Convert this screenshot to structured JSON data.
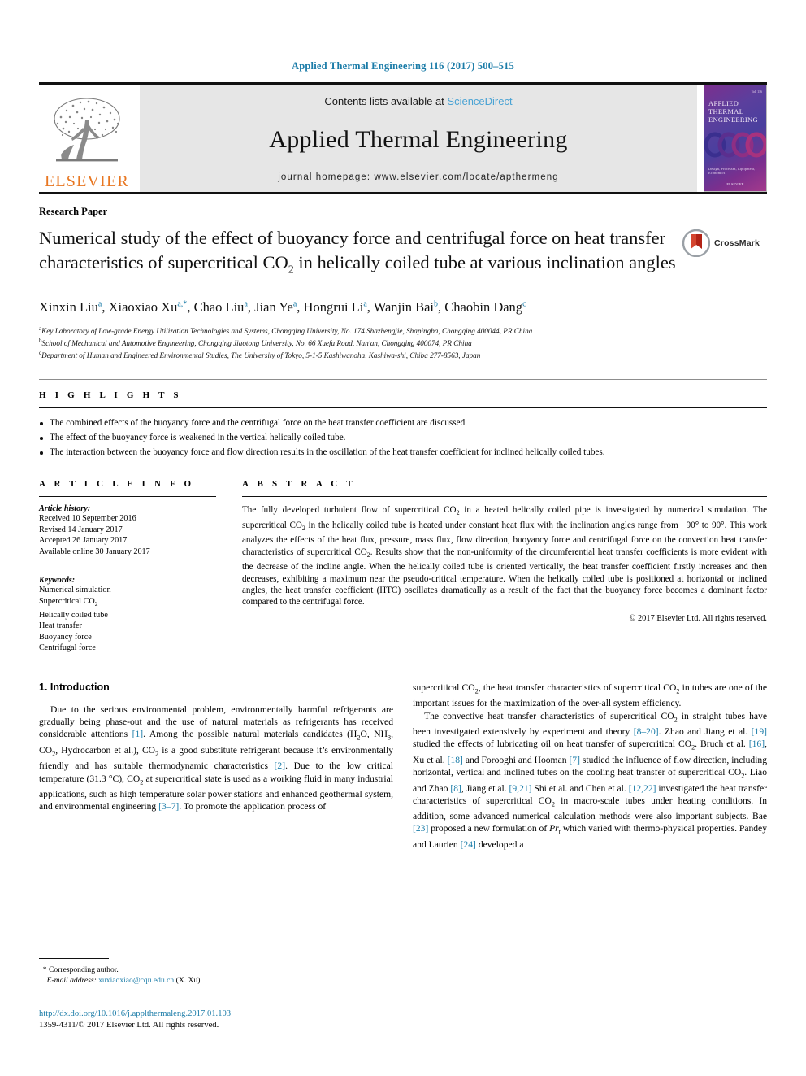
{
  "journal_ref": "Applied Thermal Engineering 116 (2017) 500–515",
  "masthead": {
    "publisher": "ELSEVIER",
    "contents_prefix": "Contents lists available at ",
    "sciencedirect": "ScienceDirect",
    "journal_title": "Applied Thermal Engineering",
    "homepage": "journal homepage: www.elsevier.com/locate/apthermeng",
    "cover": {
      "line1": "APPLIED",
      "line2": "THERMAL",
      "line3": "ENGINEERING",
      "bottom": "Design, Processes, Equipment, Economics",
      "publisher": "ELSEVIER",
      "issue": "Vol. 116"
    }
  },
  "article": {
    "doctype": "Research Paper",
    "title_part1": "Numerical study of the effect of buoyancy force and centrifugal force on heat transfer characteristics of supercritical CO",
    "title_sub": "2",
    "title_part2": " in helically coiled tube at various inclination angles",
    "crossmark_label": "CrossMark",
    "authors": [
      {
        "name": "Xinxin Liu",
        "sup": "a",
        "sep": ", "
      },
      {
        "name": "Xiaoxiao Xu",
        "sup": "a,*",
        "sep": ", "
      },
      {
        "name": "Chao Liu",
        "sup": "a",
        "sep": ", "
      },
      {
        "name": "Jian Ye",
        "sup": "a",
        "sep": ", "
      },
      {
        "name": "Hongrui Li",
        "sup": "a",
        "sep": ", "
      },
      {
        "name": "Wanjin Bai",
        "sup": "b",
        "sep": ", "
      },
      {
        "name": "Chaobin Dang",
        "sup": "c",
        "sep": ""
      }
    ],
    "affiliations": [
      {
        "sup": "a",
        "text": "Key Laboratory of Low-grade Energy Utilization Technologies and Systems, Chongqing University, No. 174 Shazhengjie, Shapingba, Chongqing 400044, PR China"
      },
      {
        "sup": "b",
        "text": "School of Mechanical and Automotive Engineering, Chongqing Jiaotong University, No. 66 Xuefu Road, Nan'an, Chongqing 400074, PR China"
      },
      {
        "sup": "c",
        "text": "Department of Human and Engineered Environmental Studies, The University of Tokyo, 5-1-5 Kashiwanoha, Kashiwa-shi, Chiba 277-8563, Japan"
      }
    ]
  },
  "highlights": {
    "label": "H I G H L I G H T S",
    "items": [
      "The combined effects of the buoyancy force and the centrifugal force on the heat transfer coefficient are discussed.",
      "The effect of the buoyancy force is weakened in the vertical helically coiled tube.",
      "The interaction between the buoyancy force and flow direction results in the oscillation of the heat transfer coefficient for inclined helically coiled tubes."
    ]
  },
  "article_info": {
    "label": "A R T I C L E   I N F O",
    "history_title": "Article history:",
    "history": [
      "Received 10 September 2016",
      "Revised 14 January 2017",
      "Accepted 26 January 2017",
      "Available online 30 January 2017"
    ],
    "keywords_title": "Keywords:",
    "keywords": [
      "Numerical simulation",
      "Supercritical CO2",
      "Helically coiled tube",
      "Heat transfer",
      "Buoyancy force",
      "Centrifugal force"
    ]
  },
  "abstract": {
    "label": "A B S T R A C T",
    "text": "The fully developed turbulent flow of supercritical CO2 in a heated helically coiled pipe is investigated by numerical simulation. The supercritical CO2 in the helically coiled tube is heated under constant heat flux with the inclination angles range from −90° to 90°. This work analyzes the effects of the heat flux, pressure, mass flux, flow direction, buoyancy force and centrifugal force on the convection heat transfer characteristics of supercritical CO2. Results show that the non-uniformity of the circumferential heat transfer coefficients is more evident with the decrease of the incline angle. When the helically coiled tube is oriented vertically, the heat transfer coefficient firstly increases and then decreases, exhibiting a maximum near the pseudo-critical temperature. When the helically coiled tube is positioned at horizontal or inclined angles, the heat transfer coefficient (HTC) oscillates dramatically as a result of the fact that the buoyancy force becomes a dominant factor compared to the centrifugal force.",
    "copyright": "© 2017 Elsevier Ltd. All rights reserved."
  },
  "introduction": {
    "heading": "1. Introduction",
    "left_para_1": "Due to the serious environmental problem, environmentally harmful refrigerants are gradually being phase-out and the use of natural materials as refrigerants has received considerable attentions [1]. Among the possible natural materials candidates (H2O, NH3, CO2, Hydrocarbon et al.), CO2 is a good substitute refrigerant because it's environmentally friendly and has suitable thermodynamic characteristics [2]. Due to the low critical temperature (31.3 °C), CO2 at supercritical state is used as a working fluid in many industrial applications, such as high temperature solar power stations and enhanced geothermal system, and environmental engineering [3–7]. To promote the application process of",
    "right_para_1": "supercritical CO2, the heat transfer characteristics of supercritical CO2 in tubes are one of the important issues for the maximization of the over-all system efficiency.",
    "right_para_2": "The convective heat transfer characteristics of supercritical CO2 in straight tubes have been investigated extensively by experiment and theory [8–20]. Zhao and Jiang et al. [19] studied the effects of lubricating oil on heat transfer of supercritical CO2. Bruch et al. [16], Xu et al. [18] and Forooghi and Hooman [7] studied the influence of flow direction, including horizontal, vertical and inclined tubes on the cooling heat transfer of supercritical CO2. Liao and Zhao [8], Jiang et al. [9,21] Shi et al. and Chen et al. [12,22] investigated the heat transfer characteristics of supercritical CO2 in macro-scale tubes under heating conditions. In addition, some advanced numerical calculation methods were also important subjects. Bae [23] proposed a new formulation of Prt which varied with thermo-physical properties. Pandey and Laurien [24] developed a"
  },
  "footer": {
    "corresponding_marker": "*",
    "corresponding_label": "Corresponding author.",
    "email_label": "E-mail address:",
    "email": "xuxiaoxiao@cqu.edu.cn",
    "email_attrib": "(X. Xu).",
    "doi": "http://dx.doi.org/10.1016/j.applthermaleng.2017.01.103",
    "issn": "1359-4311/© 2017 Elsevier Ltd. All rights reserved."
  },
  "colors": {
    "link": "#1b7ca8",
    "elsevier_orange": "#E87722",
    "sciencedirect": "#4aa3d4"
  }
}
